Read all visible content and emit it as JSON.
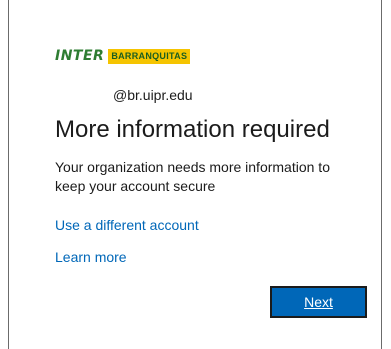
{
  "logo": {
    "brand_word": "INTER",
    "tag": "BARRANQUITAS"
  },
  "account": {
    "email": "@br.uipr.edu"
  },
  "heading": "More information required",
  "message": "Your organization needs more information to keep your account secure",
  "links": {
    "different_account": "Use a different account",
    "learn_more": "Learn more"
  },
  "buttons": {
    "next": "Next"
  },
  "colors": {
    "link": "#0067b8",
    "button_bg": "#0067b8",
    "logo_green": "#2e7d32",
    "logo_yellow": "#f5c400"
  }
}
